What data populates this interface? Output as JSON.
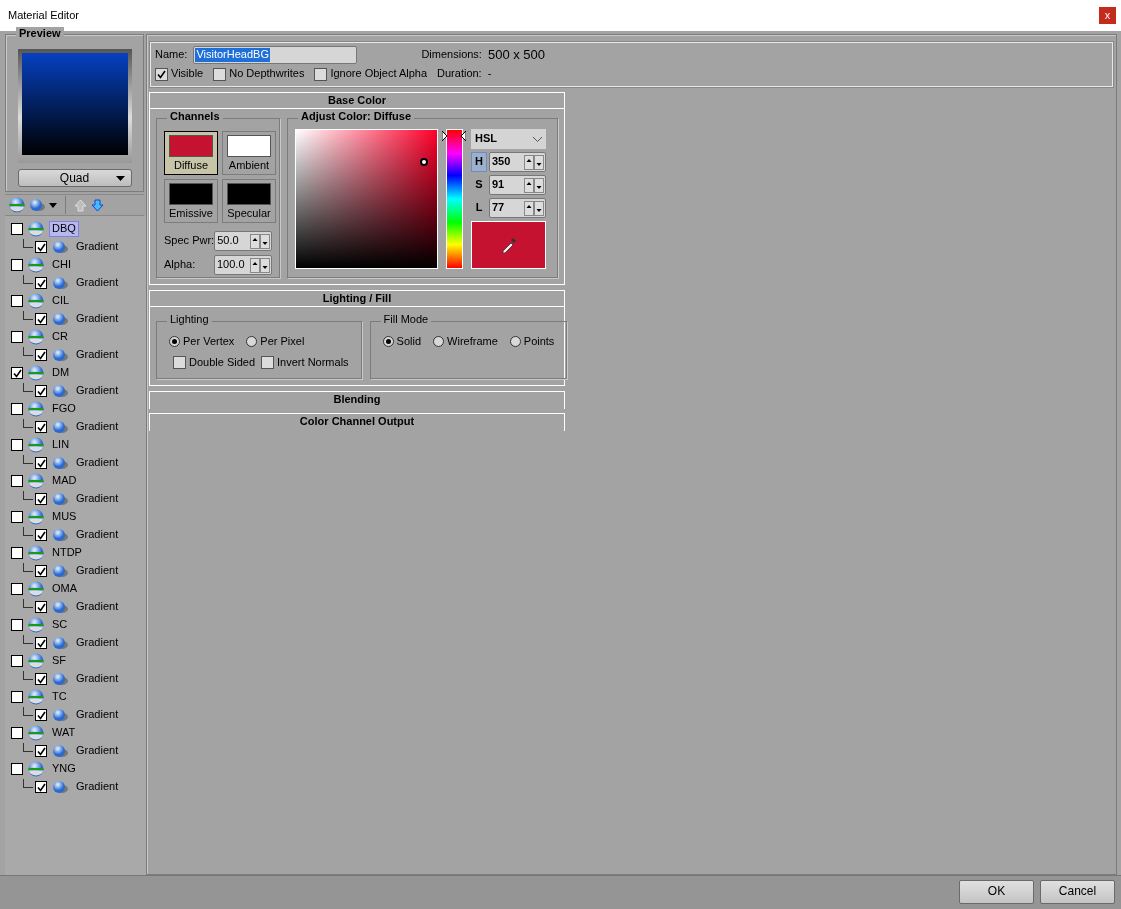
{
  "window": {
    "title": "Material Editor",
    "close_label": "x"
  },
  "preview": {
    "title": "Preview",
    "shape": "Quad"
  },
  "tree": [
    {
      "label": "DBQ",
      "checked": false,
      "selected": true,
      "children": [
        {
          "label": "Gradient",
          "checked": true
        }
      ]
    },
    {
      "label": "CHI",
      "checked": false,
      "selected": false,
      "children": [
        {
          "label": "Gradient",
          "checked": true
        }
      ]
    },
    {
      "label": "CIL",
      "checked": false,
      "selected": false,
      "children": [
        {
          "label": "Gradient",
          "checked": true
        }
      ]
    },
    {
      "label": "CR",
      "checked": false,
      "selected": false,
      "children": [
        {
          "label": "Gradient",
          "checked": true
        }
      ]
    },
    {
      "label": "DM",
      "checked": true,
      "selected": false,
      "children": [
        {
          "label": "Gradient",
          "checked": true
        }
      ]
    },
    {
      "label": "FGO",
      "checked": false,
      "selected": false,
      "children": [
        {
          "label": "Gradient",
          "checked": true
        }
      ]
    },
    {
      "label": "LIN",
      "checked": false,
      "selected": false,
      "children": [
        {
          "label": "Gradient",
          "checked": true
        }
      ]
    },
    {
      "label": "MAD",
      "checked": false,
      "selected": false,
      "children": [
        {
          "label": "Gradient",
          "checked": true
        }
      ]
    },
    {
      "label": "MUS",
      "checked": false,
      "selected": false,
      "children": [
        {
          "label": "Gradient",
          "checked": true
        }
      ]
    },
    {
      "label": "NTDP",
      "checked": false,
      "selected": false,
      "children": [
        {
          "label": "Gradient",
          "checked": true
        }
      ]
    },
    {
      "label": "OMA",
      "checked": false,
      "selected": false,
      "children": [
        {
          "label": "Gradient",
          "checked": true
        }
      ]
    },
    {
      "label": "SC",
      "checked": false,
      "selected": false,
      "children": [
        {
          "label": "Gradient",
          "checked": true
        }
      ]
    },
    {
      "label": "SF",
      "checked": false,
      "selected": false,
      "children": [
        {
          "label": "Gradient",
          "checked": true
        }
      ]
    },
    {
      "label": "TC",
      "checked": false,
      "selected": false,
      "children": [
        {
          "label": "Gradient",
          "checked": true
        }
      ]
    },
    {
      "label": "WAT",
      "checked": false,
      "selected": false,
      "children": [
        {
          "label": "Gradient",
          "checked": true
        }
      ]
    },
    {
      "label": "YNG",
      "checked": false,
      "selected": false,
      "children": [
        {
          "label": "Gradient",
          "checked": true
        }
      ]
    }
  ],
  "properties": {
    "name_label": "Name:",
    "name_value": "VisitorHeadBG",
    "dimensions_label": "Dimensions:",
    "dimensions_value": "500 x 500",
    "options": [
      {
        "label": "Visible",
        "checked": true
      },
      {
        "label": "No Depthwrites",
        "checked": false
      },
      {
        "label": "Ignore Object Alpha",
        "checked": false
      }
    ],
    "duration_label": "Duration:",
    "duration_value": "-"
  },
  "base_color": {
    "title": "Base Color",
    "channels_title": "Channels",
    "channels": [
      {
        "label": "Diffuse",
        "color": "#c41230",
        "selected": true
      },
      {
        "label": "Ambient",
        "color": "#ffffff",
        "selected": false
      },
      {
        "label": "Emissive",
        "color": "#000000",
        "selected": false
      },
      {
        "label": "Specular",
        "color": "#000000",
        "selected": false
      }
    ],
    "spinners": [
      {
        "label": "Spec Pwr:",
        "value": "50.0"
      },
      {
        "label": "Alpha:",
        "value": "100.0"
      }
    ],
    "adjust_title": "Adjust Color: Diffuse",
    "mode": "HSL",
    "fields": [
      {
        "label": "H",
        "value": "350",
        "selected": true
      },
      {
        "label": "S",
        "value": "91",
        "selected": false
      },
      {
        "label": "L",
        "value": "77",
        "selected": false
      }
    ],
    "hue_slider": {
      "level": 0.97
    }
  },
  "lighting_fill": {
    "title": "Lighting / Fill",
    "groups": [
      {
        "title": "Lighting",
        "radios": [
          {
            "label": "Per Vertex",
            "selected": true
          },
          {
            "label": "Per Pixel",
            "selected": false
          }
        ],
        "checks": [
          {
            "label": "Double Sided",
            "checked": false
          },
          {
            "label": "Invert Normals",
            "checked": false
          }
        ]
      },
      {
        "title": "Fill Mode",
        "radios": [
          {
            "label": "Solid",
            "selected": true
          },
          {
            "label": "Wireframe",
            "selected": false
          },
          {
            "label": "Points",
            "selected": false
          }
        ]
      }
    ]
  },
  "collapsed_sections": [
    "Blending",
    "Color Channel Output"
  ],
  "buttons": [
    "OK",
    "Cancel"
  ]
}
